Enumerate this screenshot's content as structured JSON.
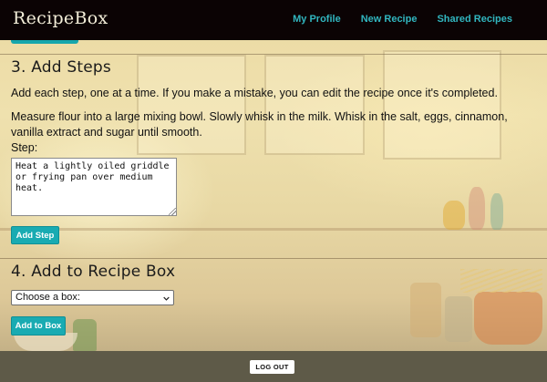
{
  "header": {
    "logo": "RecipeBox",
    "nav": [
      "My Profile",
      "New Recipe",
      "Shared Recipes"
    ]
  },
  "step3": {
    "heading": "3. Add Steps",
    "instructions": "Add each step, one at a time. If you make a mistake, you can edit the recipe once it's completed.",
    "existing_steps": "Measure flour into a large mixing bowl. Slowly whisk in the milk. Whisk in the salt, eggs, cinnamon, vanilla extract and sugar until smooth.",
    "step_label": "Step:",
    "step_value": "Heat a lightly oiled griddle or frying pan over medium heat.",
    "add_step_button": "Add Step"
  },
  "step4": {
    "heading": "4. Add to Recipe Box",
    "box_select_value": "Choose a box:",
    "add_to_box_button": "Add to Box"
  },
  "footer": {
    "logout_button": "LOG OUT"
  },
  "colors": {
    "header_bg": "#0b0304",
    "accent": "#19abb2",
    "nav_link": "#31b6bf",
    "footer_bg": "#5e5a48"
  }
}
